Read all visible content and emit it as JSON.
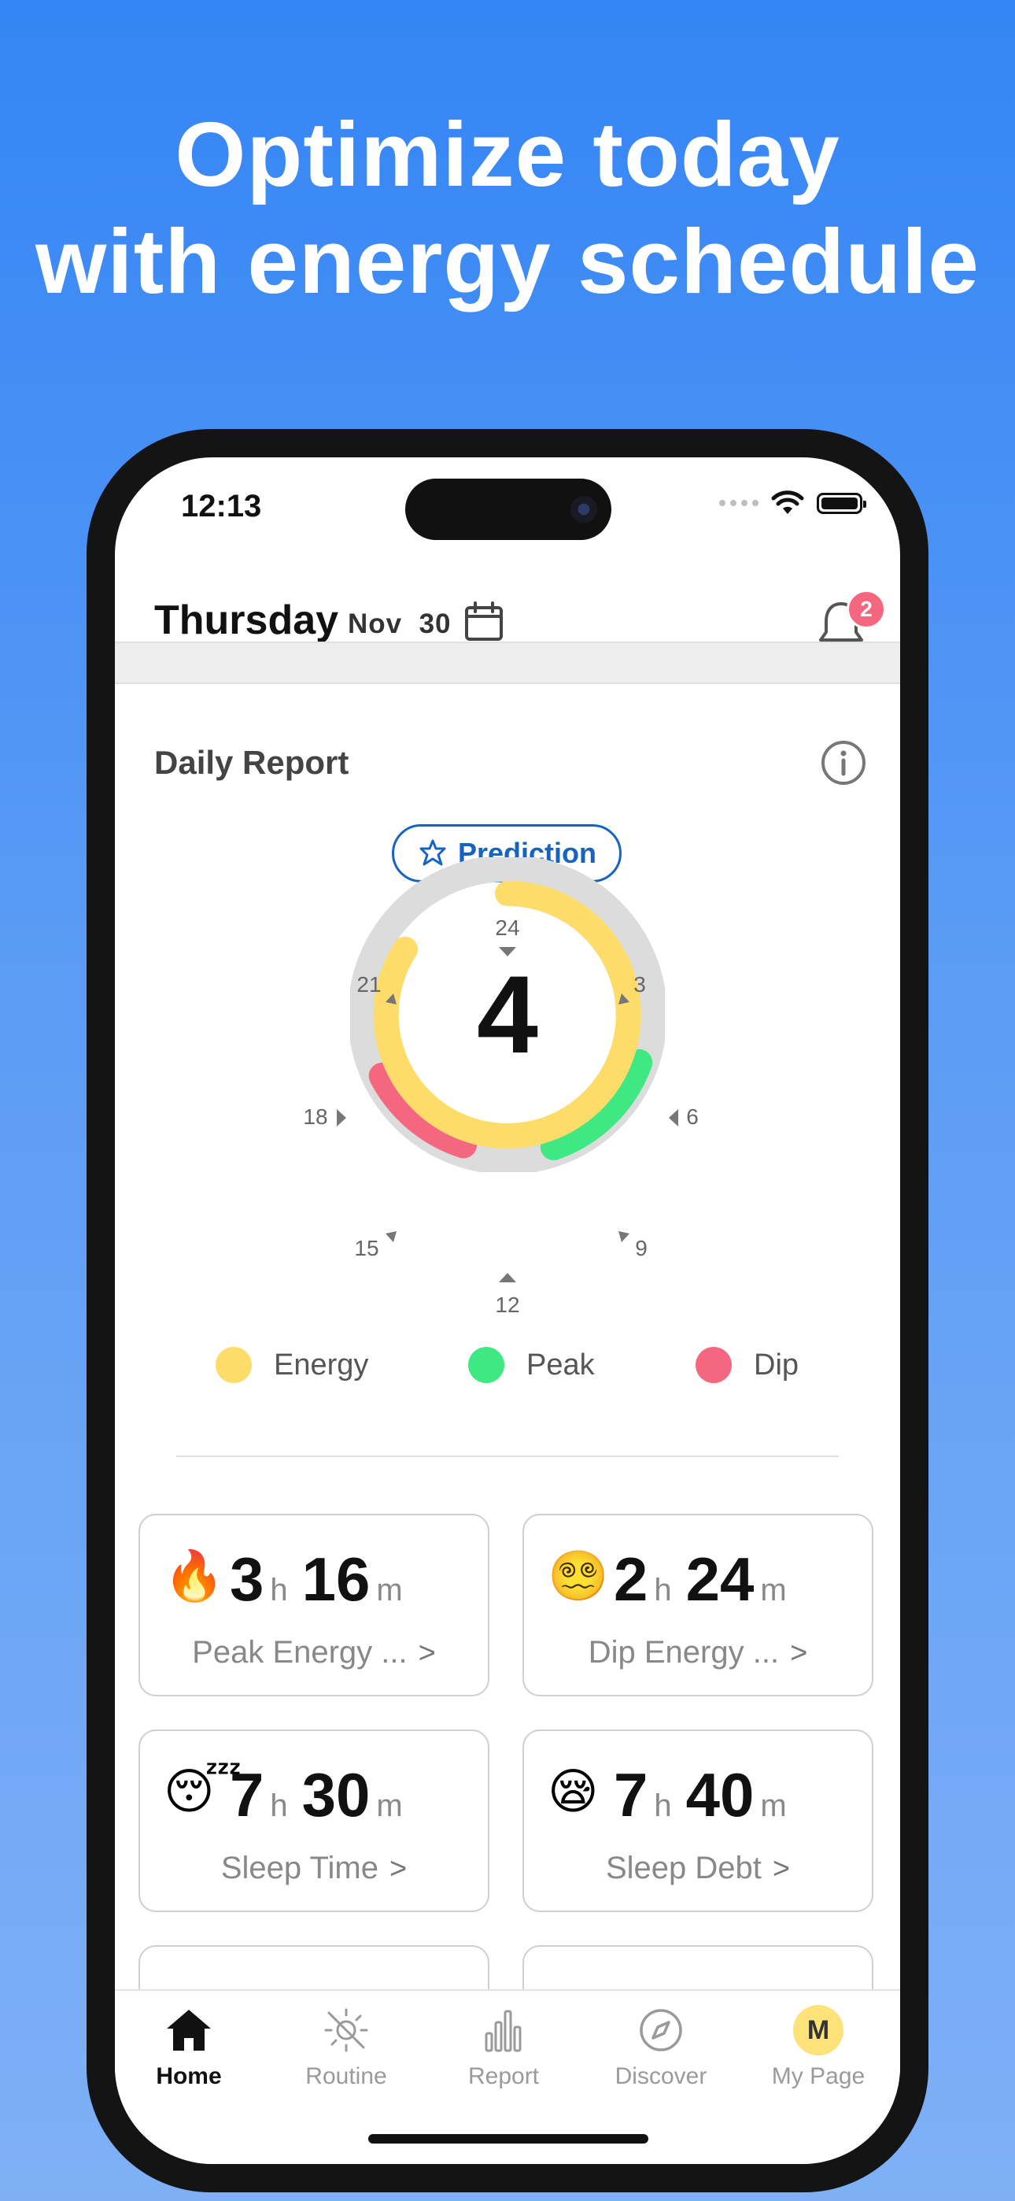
{
  "headline": {
    "line1": "Optimize today",
    "line2": "with energy schedule"
  },
  "status_bar": {
    "time": "12:13"
  },
  "header": {
    "day": "Thursday",
    "date": "Nov  30",
    "notification_count": "2"
  },
  "daily_report": {
    "title": "Daily Report",
    "prediction_label": "Prediction",
    "score": "4",
    "dial_hours": [
      "24",
      "3",
      "6",
      "9",
      "12",
      "15",
      "18",
      "21"
    ],
    "legend": [
      {
        "label": "Energy",
        "color": "#fddc6a"
      },
      {
        "label": "Peak",
        "color": "#3ee882"
      },
      {
        "label": "Dip",
        "color": "#f4677e"
      }
    ]
  },
  "cards": [
    {
      "emoji": "🔥",
      "hours": "3",
      "minutes": "16",
      "h_unit": "h",
      "m_unit": "m",
      "label": "Peak Energy ..."
    },
    {
      "emoji": "😵‍💫",
      "hours": "2",
      "minutes": "24",
      "h_unit": "h",
      "m_unit": "m",
      "label": "Dip Energy ..."
    },
    {
      "emoji": "😴",
      "hours": "7",
      "minutes": "30",
      "h_unit": "h",
      "m_unit": "m",
      "label": "Sleep Time"
    },
    {
      "emoji": "😪",
      "hours": "7",
      "minutes": "40",
      "h_unit": "h",
      "m_unit": "m",
      "label": "Sleep Debt"
    }
  ],
  "tabbar": {
    "items": [
      {
        "label": "Home",
        "icon": "home-icon",
        "active": true
      },
      {
        "label": "Routine",
        "icon": "sun-off-icon",
        "active": false
      },
      {
        "label": "Report",
        "icon": "bar-chart-icon",
        "active": false
      },
      {
        "label": "Discover",
        "icon": "compass-icon",
        "active": false
      },
      {
        "label": "My Page",
        "icon": "avatar",
        "active": false
      }
    ],
    "avatar_initial": "M"
  },
  "colors": {
    "background_top": "#3485f5",
    "accent": "#1565c0",
    "energy": "#fddc6a",
    "peak": "#3ee882",
    "dip": "#f4677e",
    "track": "#dcdcdc"
  }
}
